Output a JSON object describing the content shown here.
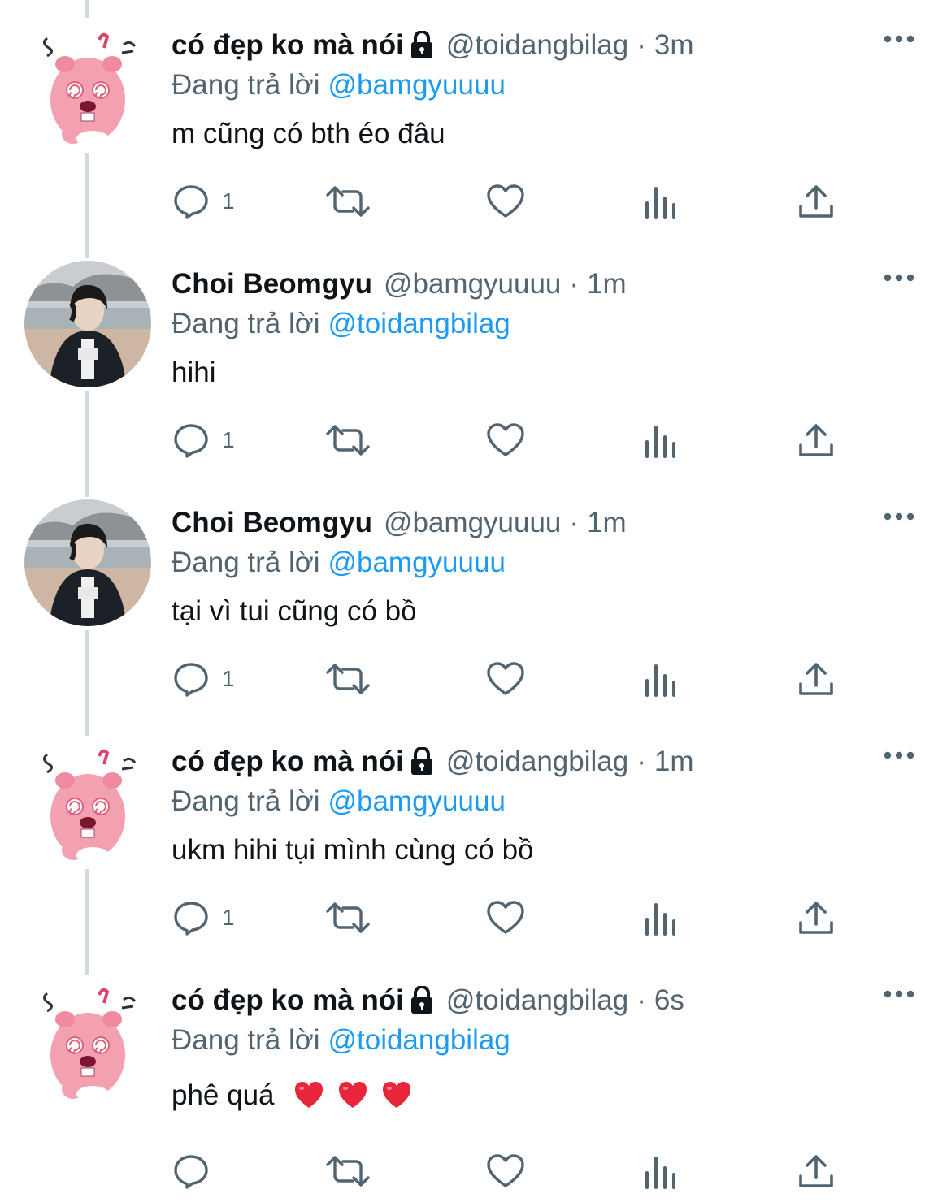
{
  "tweets": [
    {
      "name": "có đẹp ko mà nói",
      "locked": true,
      "handle": "@toidangbilag",
      "dot": "·",
      "time": "3m",
      "avatar": "pink-beaver-avatar",
      "reply_prefix": "Đang trả lời",
      "reply_to": "@bamgyuuuu",
      "text": "m cũng có bth éo đâu",
      "reply_count": "1"
    },
    {
      "name": "Choi Beomgyu",
      "locked": false,
      "handle": "@bamgyuuuu",
      "dot": "·",
      "time": "1m",
      "avatar": "beach-photo-avatar",
      "reply_prefix": "Đang trả lời",
      "reply_to": "@toidangbilag",
      "text": "hihi",
      "reply_count": "1"
    },
    {
      "name": "Choi Beomgyu",
      "locked": false,
      "handle": "@bamgyuuuu",
      "dot": "·",
      "time": "1m",
      "avatar": "beach-photo-avatar",
      "reply_prefix": "Đang trả lời",
      "reply_to": "@bamgyuuuu",
      "text": "tại vì tui cũng có bồ",
      "reply_count": "1"
    },
    {
      "name": "có đẹp ko mà nói",
      "locked": true,
      "handle": "@toidangbilag",
      "dot": "·",
      "time": "1m",
      "avatar": "pink-beaver-avatar",
      "reply_prefix": "Đang trả lời",
      "reply_to": "@bamgyuuuu",
      "text": "ukm hihi tụi mình cùng có bồ",
      "reply_count": "1"
    },
    {
      "name": "có đẹp ko mà nói",
      "locked": true,
      "handle": "@toidangbilag",
      "dot": "·",
      "time": "6s",
      "avatar": "pink-beaver-avatar",
      "reply_prefix": "Đang trả lời",
      "reply_to": "@toidangbilag",
      "text": "phê quá",
      "text_emoji": "red-heart-emoji x3",
      "reply_count": ""
    }
  ],
  "colors": {
    "text": "#0f1419",
    "secondary": "#536471",
    "mention": "#1d9bf0",
    "thread_line": "#cfd9de",
    "heart_emoji": "#e8253b"
  },
  "icons": {
    "reply": "reply-icon",
    "retweet": "retweet-icon",
    "like": "like-icon",
    "views": "views-icon",
    "share": "share-icon",
    "more": "more-icon",
    "lock": "lock-icon"
  }
}
